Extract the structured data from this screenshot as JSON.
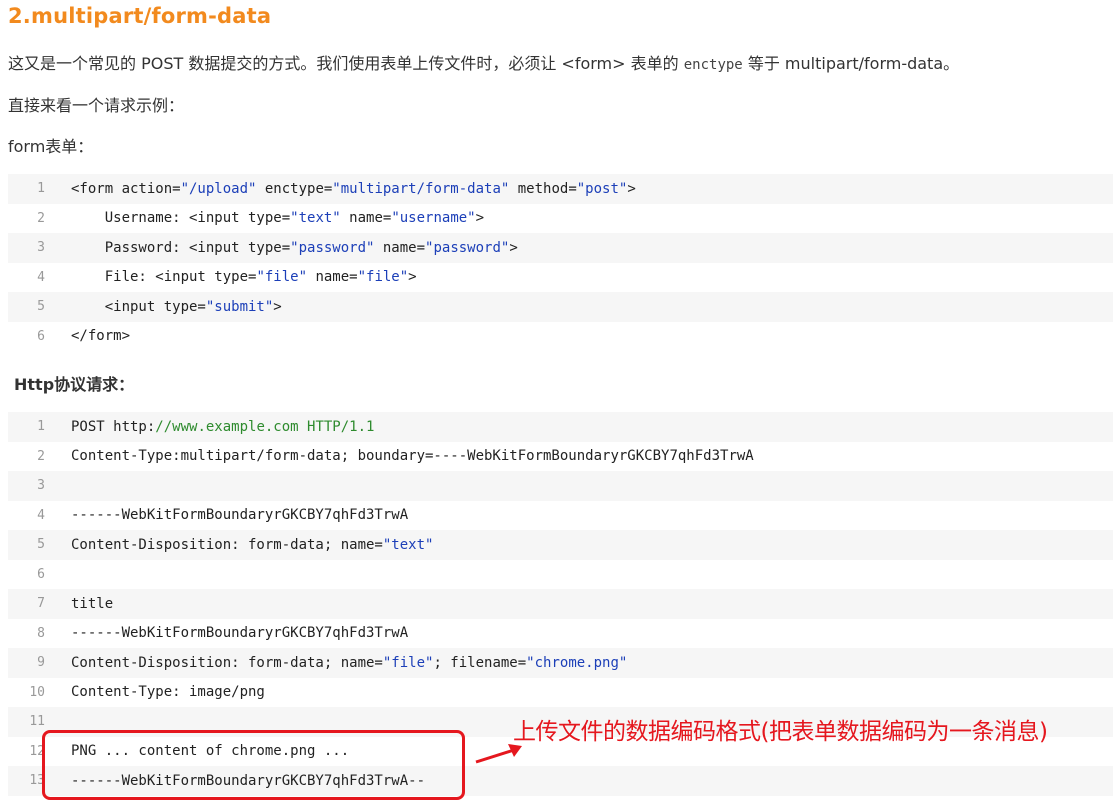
{
  "heading": "2.multipart/form-data",
  "intro": {
    "part1": "这又是一个常见的 POST 数据提交的方式。我们使用表单上传文件时，必须让 <form> 表单的 ",
    "code": "enctype",
    "part2": " 等于 multipart/form-data。"
  },
  "example_label": "直接来看一个请求示例：",
  "form_label": "form表单：",
  "http_label": "Http协议请求：",
  "form_code": [
    {
      "n": "1",
      "parts": [
        {
          "t": "<form action="
        },
        {
          "t": "\"/upload\"",
          "c": "str"
        },
        {
          "t": " enctype="
        },
        {
          "t": "\"multipart/form-data\"",
          "c": "str"
        },
        {
          "t": " method="
        },
        {
          "t": "\"post\"",
          "c": "str"
        },
        {
          "t": ">"
        }
      ]
    },
    {
      "n": "2",
      "parts": [
        {
          "t": "    Username: <input type="
        },
        {
          "t": "\"text\"",
          "c": "str"
        },
        {
          "t": " name="
        },
        {
          "t": "\"username\"",
          "c": "str"
        },
        {
          "t": ">"
        }
      ]
    },
    {
      "n": "3",
      "parts": [
        {
          "t": "    Password: <input type="
        },
        {
          "t": "\"password\"",
          "c": "str"
        },
        {
          "t": " name="
        },
        {
          "t": "\"password\"",
          "c": "str"
        },
        {
          "t": ">"
        }
      ]
    },
    {
      "n": "4",
      "parts": [
        {
          "t": "    File: <input type="
        },
        {
          "t": "\"file\"",
          "c": "str"
        },
        {
          "t": " name="
        },
        {
          "t": "\"file\"",
          "c": "str"
        },
        {
          "t": ">"
        }
      ]
    },
    {
      "n": "5",
      "parts": [
        {
          "t": "    <input type="
        },
        {
          "t": "\"submit\"",
          "c": "str"
        },
        {
          "t": ">"
        }
      ]
    },
    {
      "n": "6",
      "parts": [
        {
          "t": "</form>"
        }
      ]
    }
  ],
  "http_code": [
    {
      "n": "1",
      "parts": [
        {
          "t": "POST http:"
        },
        {
          "t": "//www.example.com HTTP/1.1",
          "c": "grn"
        }
      ]
    },
    {
      "n": "2",
      "parts": [
        {
          "t": "Content-Type:multipart/form-data; boundary=----WebKitFormBoundaryrGKCBY7qhFd3TrwA"
        }
      ]
    },
    {
      "n": "3",
      "parts": [
        {
          "t": ""
        }
      ]
    },
    {
      "n": "4",
      "parts": [
        {
          "t": "------WebKitFormBoundaryrGKCBY7qhFd3TrwA"
        }
      ]
    },
    {
      "n": "5",
      "parts": [
        {
          "t": "Content-Disposition: form-data; name="
        },
        {
          "t": "\"text\"",
          "c": "str"
        }
      ]
    },
    {
      "n": "6",
      "parts": [
        {
          "t": ""
        }
      ]
    },
    {
      "n": "7",
      "parts": [
        {
          "t": "title"
        }
      ]
    },
    {
      "n": "8",
      "parts": [
        {
          "t": "------WebKitFormBoundaryrGKCBY7qhFd3TrwA"
        }
      ]
    },
    {
      "n": "9",
      "parts": [
        {
          "t": "Content-Disposition: form-data; name="
        },
        {
          "t": "\"file\"",
          "c": "str"
        },
        {
          "t": "; filename="
        },
        {
          "t": "\"chrome.png\"",
          "c": "str"
        }
      ]
    },
    {
      "n": "10",
      "parts": [
        {
          "t": "Content-Type: image/png"
        }
      ]
    },
    {
      "n": "11",
      "parts": [
        {
          "t": ""
        }
      ]
    },
    {
      "n": "12",
      "parts": [
        {
          "t": "PNG ... content of chrome.png ..."
        }
      ]
    },
    {
      "n": "13",
      "parts": [
        {
          "t": "------WebKitFormBoundaryrGKCBY7qhFd3TrwA--"
        }
      ]
    }
  ],
  "annotation": "上传文件的数据编码格式(把表单数据编码为一条消息)",
  "colors": {
    "heading": "#f28a1e",
    "string": "#1c3fb8",
    "url": "#2e8b2e",
    "annotation": "#e5171e",
    "gutter": "#6ac96a"
  }
}
